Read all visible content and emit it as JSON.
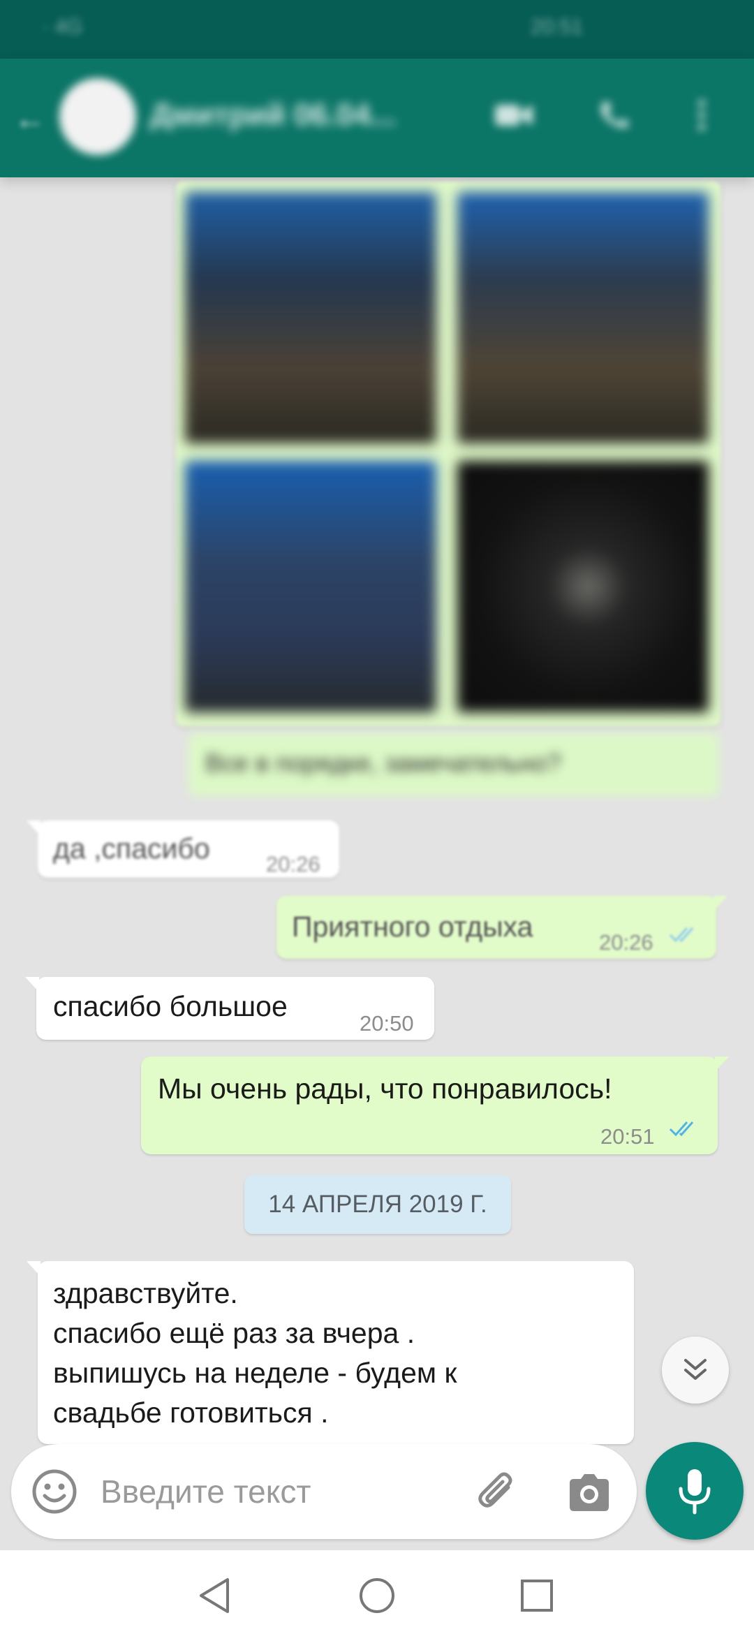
{
  "status_bar": {
    "left_text": "· 4G",
    "right_text": "20:51"
  },
  "header": {
    "contact_name": "Дмитрий 06.04..."
  },
  "photo_caption": {
    "text": "Все в порядке, замечательно?"
  },
  "messages": [
    {
      "direction": "in",
      "text": "да ,спасибо",
      "time": "20:26"
    },
    {
      "direction": "out",
      "text": "Приятного отдыха",
      "time": "20:26",
      "status": "read"
    },
    {
      "direction": "in",
      "text": "спасибо большое",
      "time": "20:50"
    },
    {
      "direction": "out",
      "text": "Мы очень рады, что понравилось!",
      "time": "20:51",
      "status": "read"
    },
    {
      "direction": "in",
      "lines": [
        "здравствуйте.",
        "спасибо ещё раз за вчера .",
        "выпишусь на неделе - будем к",
        "свадьбе готовиться ."
      ]
    }
  ],
  "date_separator": "14 АПРЕЛЯ 2019 Г.",
  "composer": {
    "placeholder": "Введите текст",
    "value": ""
  },
  "colors": {
    "header": "#0b7566",
    "outgoing_bubble": "#e1fbc9",
    "incoming_bubble": "#ffffff",
    "read_ticks": "#4fb3e8",
    "mic_button": "#0a897a",
    "chat_background": "#e3e3e3"
  },
  "icons": {
    "back": "arrow-left-icon",
    "video": "video-camera-icon",
    "call": "phone-icon",
    "menu": "more-vertical-icon",
    "emoji": "smiley-icon",
    "attach": "paperclip-icon",
    "camera": "camera-icon",
    "mic": "microphone-icon",
    "scroll": "double-chevron-down-icon"
  }
}
